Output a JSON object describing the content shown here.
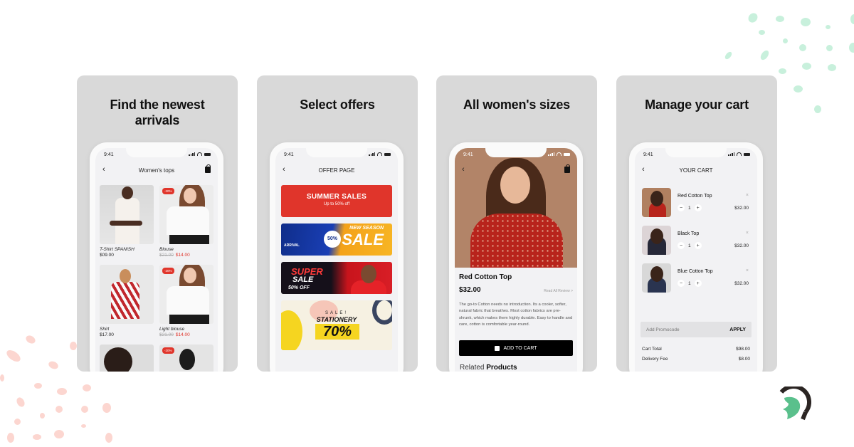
{
  "colors": {
    "card_bg": "#d9d9d9",
    "accent_red": "#e0352b",
    "logo_green": "#5ac08c",
    "logo_dark": "#2b2523",
    "deco_green": "#c8f0dc",
    "deco_pink": "#fcd6d0"
  },
  "status_bar": {
    "time": "9:41"
  },
  "cards": [
    {
      "title": "Find the newest arrivals",
      "screen": {
        "nav_title": "Women's tops",
        "products": [
          {
            "name": "T-Shirt SPANISH",
            "price": "$09.00",
            "old_price": "",
            "new_price": "",
            "badge": ""
          },
          {
            "name": "Blouse",
            "price": "",
            "old_price": "$21.00",
            "new_price": "$14.00",
            "badge": "-20%"
          },
          {
            "name": "Shirt",
            "price": "$17.00",
            "old_price": "",
            "new_price": "",
            "badge": ""
          },
          {
            "name": "Light blouse",
            "price": "",
            "old_price": "$21.00",
            "new_price": "$14.00",
            "badge": "-20%"
          },
          {
            "name": "",
            "price": "",
            "old_price": "",
            "new_price": "",
            "badge": ""
          },
          {
            "name": "",
            "price": "",
            "old_price": "",
            "new_price": "",
            "badge": "-20%"
          }
        ]
      }
    },
    {
      "title": "Select offers",
      "screen": {
        "nav_title": "OFFER PAGE",
        "banners": {
          "summer": {
            "title": "SUMMER SALES",
            "subtitle": "Up to 50% off"
          },
          "season": {
            "percent": "50%",
            "line1": "NEW SEASON",
            "line2": "SALE",
            "arrival": "ARRIVAL"
          },
          "super": {
            "line1": "SUPER",
            "line2": "SALE",
            "line3": "50% OFF"
          },
          "stationery": {
            "line1": "SALE!",
            "line2": "STATIONERY",
            "line3": "70%"
          }
        }
      }
    },
    {
      "title": "All women's sizes",
      "screen": {
        "product_name": "Red Cotton Top",
        "price": "$32.00",
        "review_link": "Read All Review >",
        "description": "The go-to Cotton needs no introduction. Its a cooler, softer, natural fabric that breathes. Most cotton fabrics are pre-shrunk, which makes them highly durable. Easy to handle and care, cotton is comfortable year-round.",
        "add_to_cart": "ADD TO CART",
        "related_prefix": "Related",
        "related_bold": "Products"
      }
    },
    {
      "title": "Manage your cart",
      "screen": {
        "nav_title": "YOUR CART",
        "items": [
          {
            "name": "Red Cotton Top",
            "qty": "1",
            "price": "$32.00"
          },
          {
            "name": "Black Top",
            "qty": "1",
            "price": "$32.00"
          },
          {
            "name": "Blue Cotton Top",
            "qty": "1",
            "price": "$32.00"
          }
        ],
        "promo_placeholder": "Add Promocode",
        "apply_label": "APPLY",
        "summary": [
          {
            "label": "Cart Total",
            "value": "$98.00"
          },
          {
            "label": "Delivery Fee",
            "value": "$8.00"
          }
        ]
      }
    }
  ],
  "icons": {
    "back": "‹",
    "remove": "×",
    "minus": "−",
    "plus": "+"
  }
}
